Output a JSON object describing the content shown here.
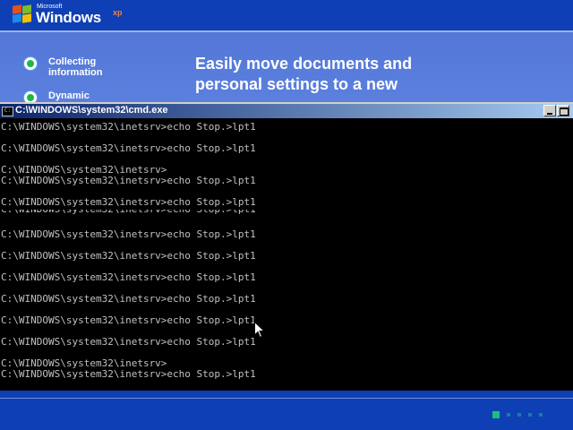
{
  "setup": {
    "logo_small": "Microsoft",
    "logo_text": "Windows",
    "logo_sup": "xp",
    "steps": [
      {
        "label_line1": "Collecting",
        "label_line2": "information"
      },
      {
        "label_line1": "Dynamic",
        "label_line2": ""
      }
    ],
    "headline": "Easily move documents and\npersonal settings to a new"
  },
  "cmd": {
    "title": "C:\\WINDOWS\\system32\\cmd.exe",
    "lines": [
      "C:\\WINDOWS\\system32\\inetsrv>echo Stop.>lpt1",
      "C:\\WINDOWS\\system32\\inetsrv>echo Stop.>lpt1",
      "C:\\WINDOWS\\system32\\inetsrv>",
      "C:\\WINDOWS\\system32\\inetsrv>echo Stop.>lpt1",
      "C:\\WINDOWS\\system32\\inetsrv>echo Stop.>lpt1",
      "C:\\WINDOWS\\system32\\inetsrv>echo Stop.>lpt1",
      "C:\\WINDOWS\\system32\\inetsrv>echo Stop.>lpt1",
      "C:\\WINDOWS\\system32\\inetsrv>echo Stop.>lpt1",
      "C:\\WINDOWS\\system32\\inetsrv>echo Stop.>lpt1",
      "C:\\WINDOWS\\system32\\inetsrv>echo Stop.>lpt1",
      "C:\\WINDOWS\\system32\\inetsrv>echo Stop.>lpt1",
      "C:\\WINDOWS\\system32\\inetsrv>",
      "C:\\WINDOWS\\system32\\inetsrv>echo Stop.>lpt1"
    ]
  },
  "progress": {
    "total_dots": 5,
    "active_index": 0
  },
  "colors": {
    "setup_blue": "#5a7edc",
    "bar_blue": "#0f3fb4",
    "console_text": "#c0c0c0",
    "active_dot": "#19c07a"
  }
}
